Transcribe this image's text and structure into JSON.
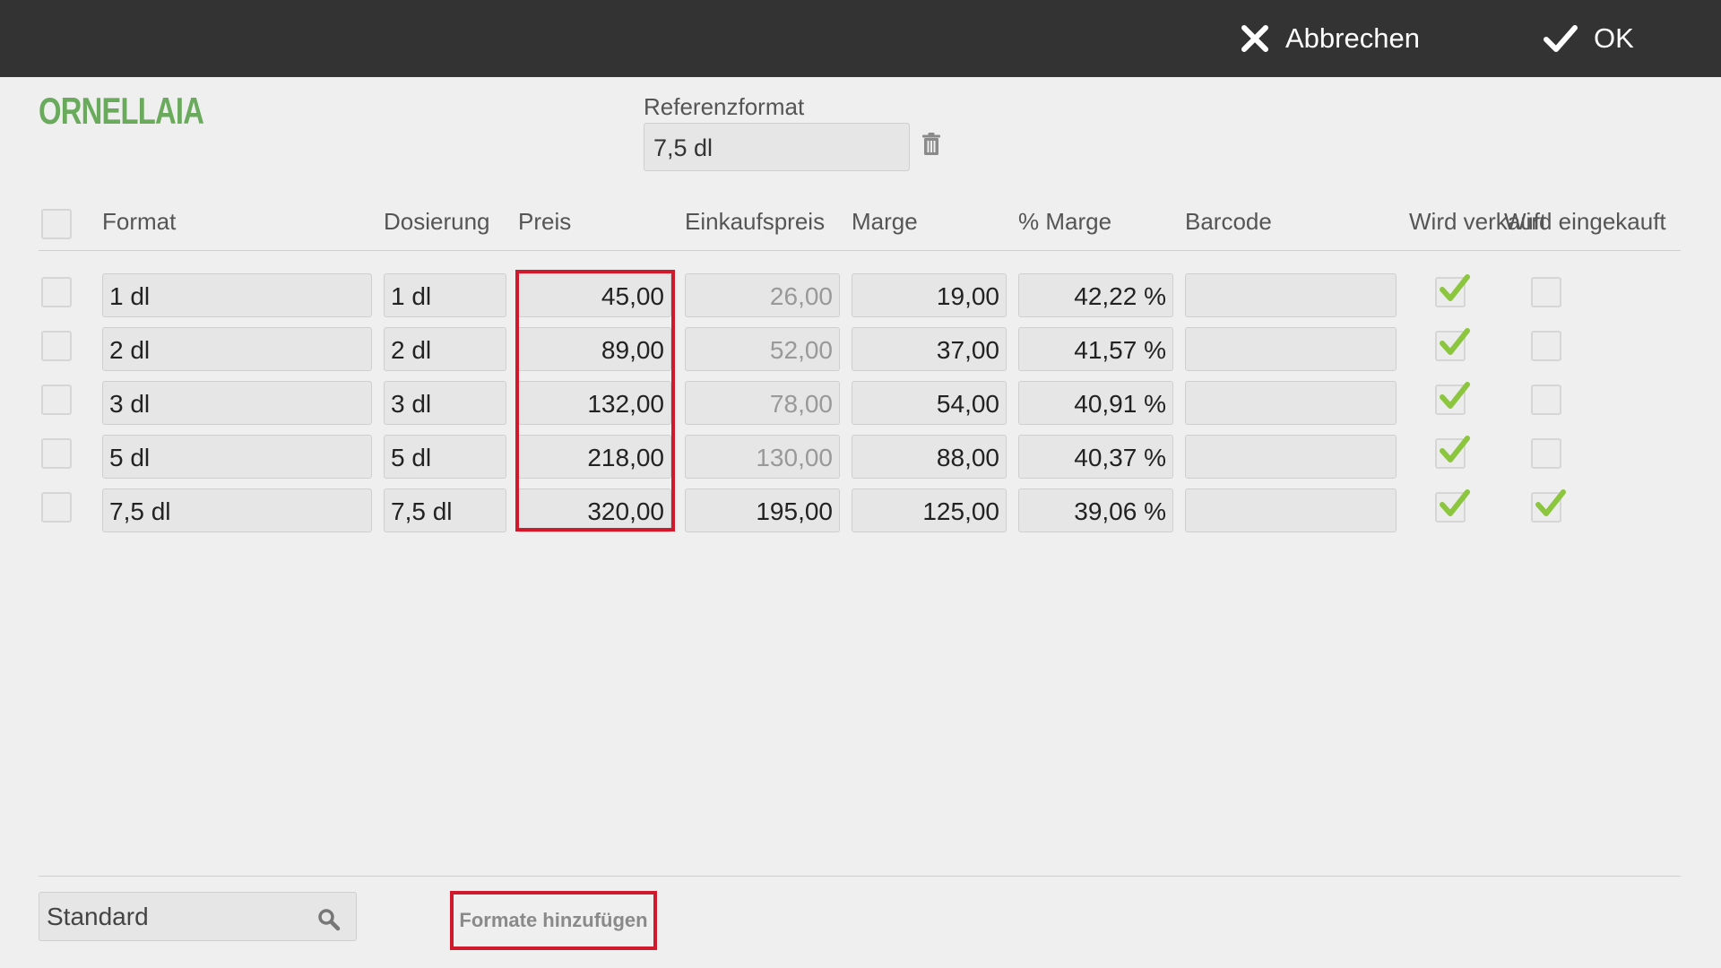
{
  "toolbar": {
    "cancel_label": "Abbrechen",
    "ok_label": "OK"
  },
  "product": {
    "title": "ORNELLAIA"
  },
  "reference": {
    "label": "Referenzformat",
    "value": "7,5 dl"
  },
  "table": {
    "columns": {
      "format": "Format",
      "dosierung": "Dosierung",
      "preis": "Preis",
      "einkaufspreis": "Einkaufspreis",
      "marge": "Marge",
      "prozent_marge": "% Marge",
      "barcode": "Barcode",
      "wird_verkauft": "Wird verkauft",
      "wird_eingekauft": "Wird eingekauft"
    },
    "rows": [
      {
        "format": "1 dl",
        "dosierung": "1 dl",
        "preis": "45,00",
        "einkaufspreis": "26,00",
        "marge": "19,00",
        "prozent_marge": "42,22 %",
        "barcode": "",
        "verkauft": true,
        "eingekauft": false,
        "einkaufspreis_muted": true
      },
      {
        "format": "2 dl",
        "dosierung": "2 dl",
        "preis": "89,00",
        "einkaufspreis": "52,00",
        "marge": "37,00",
        "prozent_marge": "41,57 %",
        "barcode": "",
        "verkauft": true,
        "eingekauft": false,
        "einkaufspreis_muted": true
      },
      {
        "format": "3 dl",
        "dosierung": "3 dl",
        "preis": "132,00",
        "einkaufspreis": "78,00",
        "marge": "54,00",
        "prozent_marge": "40,91 %",
        "barcode": "",
        "verkauft": true,
        "eingekauft": false,
        "einkaufspreis_muted": true
      },
      {
        "format": "5 dl",
        "dosierung": "5 dl",
        "preis": "218,00",
        "einkaufspreis": "130,00",
        "marge": "88,00",
        "prozent_marge": "40,37 %",
        "barcode": "",
        "verkauft": true,
        "eingekauft": false,
        "einkaufspreis_muted": true
      },
      {
        "format": "7,5 dl",
        "dosierung": "7,5 dl",
        "preis": "320,00",
        "einkaufspreis": "195,00",
        "marge": "125,00",
        "prozent_marge": "39,06 %",
        "barcode": "",
        "verkauft": true,
        "eingekauft": true,
        "einkaufspreis_muted": false
      }
    ]
  },
  "footer": {
    "search_value": "Standard",
    "add_formats_label": "Formate hinzufügen"
  },
  "colors": {
    "topbar": "#333333",
    "accent_green": "#6aaa5c",
    "check_green": "#8cc63f",
    "highlight_red": "#d0192b"
  }
}
